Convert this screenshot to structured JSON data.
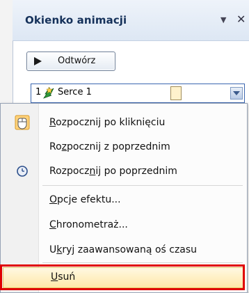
{
  "pane": {
    "title": "Okienko animacji"
  },
  "play_button": {
    "label": "Odtwórz"
  },
  "animation_item": {
    "number": "1",
    "name": "Serce 1"
  },
  "menu": {
    "items": [
      {
        "label": "Rozpocznij po kliknięciu",
        "icon": "mouse-click-icon"
      },
      {
        "label": "Rozpocznij z poprzednim",
        "icon": ""
      },
      {
        "label": "Rozpocznij po poprzednim",
        "icon": "clock-icon"
      },
      {
        "label": "Opcje efektu...",
        "icon": ""
      },
      {
        "label": "Chronometraż...",
        "icon": ""
      },
      {
        "label": "Ukryj zaawansowaną oś czasu",
        "icon": ""
      },
      {
        "label": "Usuń",
        "icon": ""
      }
    ]
  },
  "colors": {
    "highlight_border": "#e00000",
    "title_color": "#15315a"
  }
}
